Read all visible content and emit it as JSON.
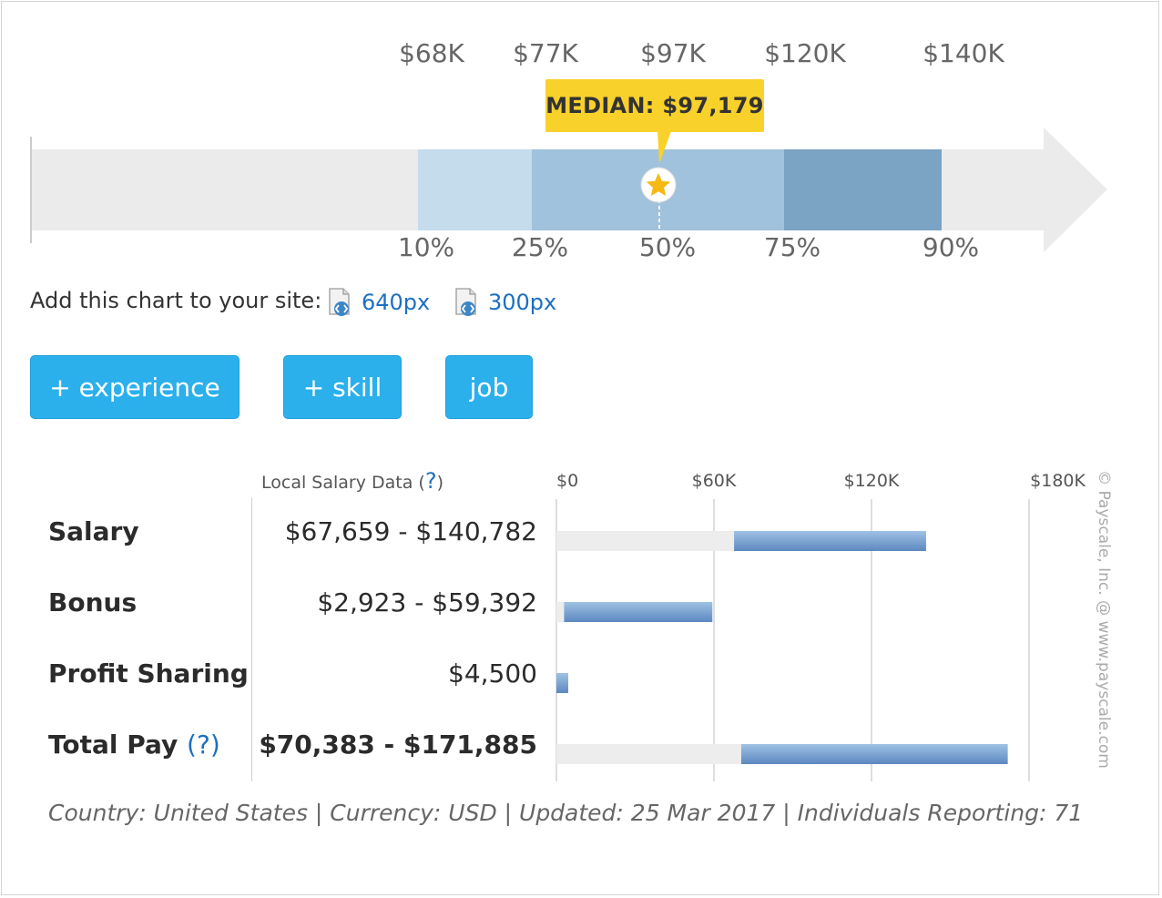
{
  "chart_data": [
    {
      "type": "bar",
      "title": "",
      "x_axis": [
        "10%",
        "25%",
        "50%",
        "75%",
        "90%"
      ],
      "percentile_labels": [
        "10%",
        "25%",
        "50%",
        "75%",
        "90%"
      ],
      "percentile_values": [
        "$68K",
        "$77K",
        "$97K",
        "$120K",
        "$140K"
      ],
      "values": [
        68000,
        77000,
        97000,
        120000,
        140000
      ],
      "median_label": "MEDIAN: $97,179",
      "median_value": 97179,
      "colors": {
        "10-25": "#c5dcec",
        "25-75": "#a0c2dc",
        "75-90": "#7aa3c4",
        "track": "#ebebeb",
        "median": "#f8d12b"
      }
    },
    {
      "type": "bar",
      "title": "",
      "header": "Local Salary Data",
      "help_mark": "?",
      "x_ticks": [
        "$0",
        "$60K",
        "$120K",
        "$180K"
      ],
      "xlim": [
        0,
        180000
      ],
      "rows": [
        {
          "label": "Salary",
          "range_text": "$67,659 - $140,782",
          "low": 67659,
          "high": 140782,
          "bold": false,
          "help": ""
        },
        {
          "label": "Bonus",
          "range_text": "$2,923 - $59,392",
          "low": 2923,
          "high": 59392,
          "bold": false,
          "help": ""
        },
        {
          "label": "Profit Sharing",
          "range_text": "$4,500",
          "low": 0,
          "high": 4500,
          "bold": false,
          "help": ""
        },
        {
          "label": "Total Pay",
          "range_text": "$70,383 - $171,885",
          "low": 70383,
          "high": 171885,
          "bold": true,
          "help": "?"
        }
      ]
    }
  ],
  "embed": {
    "text": "Add this chart to your site:",
    "link_640": "640px",
    "link_300": "300px"
  },
  "buttons": {
    "experience": "+ experience",
    "skill": "+ skill",
    "job": "job"
  },
  "paren_open": "(",
  "paren_close": ")",
  "footer": "Country: United States | Currency: USD | Updated: 25 Mar 2017 | Individuals Reporting: 71",
  "copyright": "© Payscale, Inc. @ www.payscale.com"
}
